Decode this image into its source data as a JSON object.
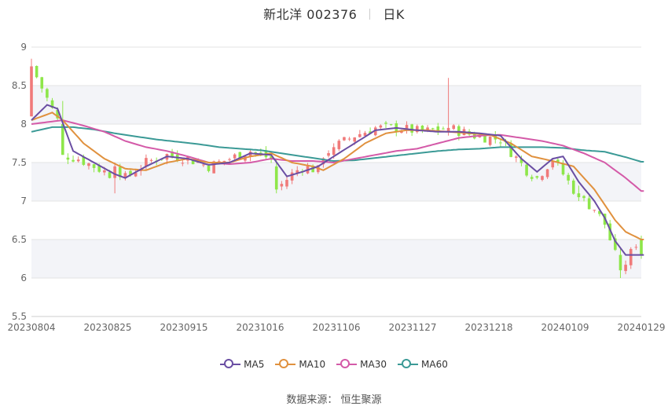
{
  "header": {
    "name": "新北洋 002376",
    "period": "日K"
  },
  "source": "数据来源：  恒生聚源",
  "colors": {
    "up": "#f07a7a",
    "down": "#8ee64a",
    "MA5": "#6a4ea3",
    "MA10": "#e0913e",
    "MA30": "#d45aa8",
    "MA60": "#3b9a96"
  },
  "chart_data": {
    "type": "candlestick",
    "ylim": [
      5.5,
      9
    ],
    "yticks": [
      5.5,
      6,
      6.5,
      7,
      7.5,
      8,
      8.5,
      9
    ],
    "xticks": [
      "20230804",
      "20230825",
      "20230915",
      "20231016",
      "20231106",
      "20231127",
      "20231218",
      "20240109",
      "20240129"
    ],
    "legend": [
      "MA5",
      "MA10",
      "MA30",
      "MA60"
    ],
    "n_candles": 118,
    "ohlc_key_points": [
      {
        "i": 0,
        "date": "20230804",
        "open": 8.1,
        "high": 8.85,
        "low": 8.1,
        "close": 8.75
      },
      {
        "i": 6,
        "open": 8.0,
        "high": 8.3,
        "low": 7.6,
        "close": 7.6
      },
      {
        "i": 16,
        "date": "20230825",
        "open": 7.3,
        "high": 7.5,
        "low": 7.1,
        "close": 7.45
      },
      {
        "i": 47,
        "date": "20231016",
        "open": 7.45,
        "high": 7.55,
        "low": 7.1,
        "close": 7.15
      },
      {
        "i": 58,
        "date": "20231106",
        "open": 7.6,
        "high": 7.75,
        "low": 7.55,
        "close": 7.7
      },
      {
        "i": 80,
        "open": 7.9,
        "high": 8.6,
        "low": 7.85,
        "close": 7.95
      },
      {
        "i": 105,
        "date": "20240109",
        "open": 7.1,
        "high": 7.2,
        "low": 7.0,
        "close": 7.05
      },
      {
        "i": 113,
        "open": 6.3,
        "high": 6.4,
        "low": 6.0,
        "close": 6.1
      },
      {
        "i": 117,
        "date": "20240129",
        "open": 6.5,
        "high": 6.55,
        "low": 6.25,
        "close": 6.3
      }
    ],
    "close_anchors": [
      [
        0,
        8.75
      ],
      [
        5,
        8.05
      ],
      [
        6,
        7.6
      ],
      [
        9,
        7.55
      ],
      [
        12,
        7.45
      ],
      [
        15,
        7.35
      ],
      [
        16,
        7.45
      ],
      [
        18,
        7.3
      ],
      [
        22,
        7.5
      ],
      [
        26,
        7.6
      ],
      [
        30,
        7.55
      ],
      [
        34,
        7.45
      ],
      [
        38,
        7.55
      ],
      [
        42,
        7.65
      ],
      [
        46,
        7.55
      ],
      [
        47,
        7.15
      ],
      [
        50,
        7.35
      ],
      [
        52,
        7.45
      ],
      [
        55,
        7.4
      ],
      [
        56,
        7.6
      ],
      [
        58,
        7.7
      ],
      [
        62,
        7.85
      ],
      [
        66,
        7.95
      ],
      [
        70,
        7.95
      ],
      [
        75,
        7.9
      ],
      [
        80,
        7.95
      ],
      [
        85,
        7.85
      ],
      [
        90,
        7.8
      ],
      [
        95,
        7.4
      ],
      [
        97,
        7.3
      ],
      [
        100,
        7.55
      ],
      [
        103,
        7.25
      ],
      [
        105,
        7.05
      ],
      [
        108,
        6.9
      ],
      [
        110,
        6.7
      ],
      [
        112,
        6.3
      ],
      [
        113,
        6.1
      ],
      [
        114,
        6.2
      ],
      [
        116,
        6.45
      ],
      [
        117,
        6.3
      ]
    ],
    "ma_anchors": {
      "MA5": [
        [
          0,
          8.05
        ],
        [
          3,
          8.25
        ],
        [
          5,
          8.2
        ],
        [
          8,
          7.65
        ],
        [
          12,
          7.5
        ],
        [
          16,
          7.35
        ],
        [
          18,
          7.3
        ],
        [
          22,
          7.45
        ],
        [
          26,
          7.58
        ],
        [
          30,
          7.55
        ],
        [
          34,
          7.47
        ],
        [
          38,
          7.5
        ],
        [
          42,
          7.62
        ],
        [
          46,
          7.6
        ],
        [
          49,
          7.32
        ],
        [
          52,
          7.38
        ],
        [
          55,
          7.45
        ],
        [
          58,
          7.58
        ],
        [
          62,
          7.75
        ],
        [
          66,
          7.92
        ],
        [
          70,
          7.95
        ],
        [
          74,
          7.92
        ],
        [
          78,
          7.9
        ],
        [
          82,
          7.9
        ],
        [
          86,
          7.88
        ],
        [
          90,
          7.85
        ],
        [
          94,
          7.55
        ],
        [
          97,
          7.38
        ],
        [
          100,
          7.55
        ],
        [
          102,
          7.58
        ],
        [
          105,
          7.25
        ],
        [
          108,
          7.0
        ],
        [
          110,
          6.78
        ],
        [
          112,
          6.48
        ],
        [
          114,
          6.3
        ],
        [
          117,
          6.3
        ]
      ],
      "MA10": [
        [
          0,
          8.05
        ],
        [
          4,
          8.15
        ],
        [
          6,
          8.05
        ],
        [
          10,
          7.75
        ],
        [
          14,
          7.55
        ],
        [
          18,
          7.42
        ],
        [
          22,
          7.4
        ],
        [
          26,
          7.5
        ],
        [
          30,
          7.55
        ],
        [
          34,
          7.5
        ],
        [
          38,
          7.5
        ],
        [
          42,
          7.58
        ],
        [
          46,
          7.62
        ],
        [
          50,
          7.5
        ],
        [
          54,
          7.45
        ],
        [
          56,
          7.4
        ],
        [
          60,
          7.55
        ],
        [
          64,
          7.75
        ],
        [
          68,
          7.88
        ],
        [
          72,
          7.92
        ],
        [
          76,
          7.92
        ],
        [
          80,
          7.9
        ],
        [
          84,
          7.88
        ],
        [
          88,
          7.86
        ],
        [
          92,
          7.75
        ],
        [
          96,
          7.58
        ],
        [
          100,
          7.52
        ],
        [
          104,
          7.45
        ],
        [
          106,
          7.3
        ],
        [
          108,
          7.15
        ],
        [
          110,
          6.95
        ],
        [
          112,
          6.75
        ],
        [
          114,
          6.6
        ],
        [
          117,
          6.5
        ]
      ],
      "MA30": [
        [
          0,
          8.0
        ],
        [
          6,
          8.05
        ],
        [
          10,
          7.98
        ],
        [
          14,
          7.9
        ],
        [
          18,
          7.78
        ],
        [
          22,
          7.7
        ],
        [
          26,
          7.65
        ],
        [
          30,
          7.58
        ],
        [
          34,
          7.5
        ],
        [
          38,
          7.48
        ],
        [
          42,
          7.5
        ],
        [
          46,
          7.55
        ],
        [
          50,
          7.52
        ],
        [
          54,
          7.52
        ],
        [
          58,
          7.5
        ],
        [
          62,
          7.55
        ],
        [
          66,
          7.6
        ],
        [
          70,
          7.65
        ],
        [
          74,
          7.68
        ],
        [
          78,
          7.75
        ],
        [
          82,
          7.82
        ],
        [
          86,
          7.85
        ],
        [
          90,
          7.86
        ],
        [
          94,
          7.82
        ],
        [
          98,
          7.78
        ],
        [
          102,
          7.72
        ],
        [
          106,
          7.62
        ],
        [
          110,
          7.5
        ],
        [
          114,
          7.3
        ],
        [
          117,
          7.13
        ]
      ],
      "MA60": [
        [
          0,
          7.9
        ],
        [
          4,
          7.96
        ],
        [
          8,
          7.96
        ],
        [
          12,
          7.93
        ],
        [
          16,
          7.88
        ],
        [
          20,
          7.84
        ],
        [
          24,
          7.8
        ],
        [
          28,
          7.77
        ],
        [
          32,
          7.74
        ],
        [
          36,
          7.7
        ],
        [
          40,
          7.68
        ],
        [
          44,
          7.66
        ],
        [
          48,
          7.62
        ],
        [
          52,
          7.58
        ],
        [
          56,
          7.54
        ],
        [
          58,
          7.52
        ],
        [
          62,
          7.53
        ],
        [
          66,
          7.56
        ],
        [
          70,
          7.59
        ],
        [
          74,
          7.62
        ],
        [
          78,
          7.65
        ],
        [
          82,
          7.67
        ],
        [
          86,
          7.68
        ],
        [
          90,
          7.7
        ],
        [
          94,
          7.7
        ],
        [
          98,
          7.7
        ],
        [
          102,
          7.69
        ],
        [
          106,
          7.66
        ],
        [
          110,
          7.64
        ],
        [
          114,
          7.57
        ],
        [
          117,
          7.51
        ]
      ]
    }
  }
}
